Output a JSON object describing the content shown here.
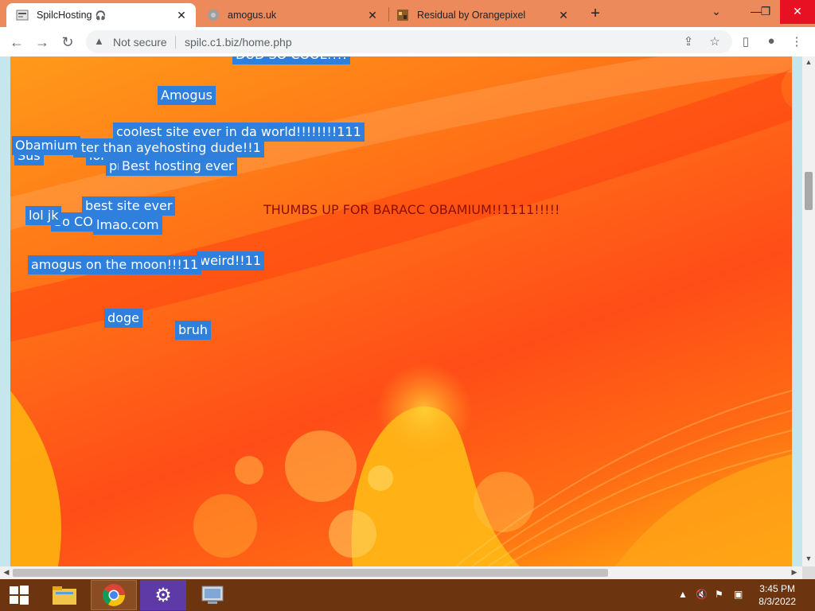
{
  "tabs": [
    {
      "title": "SpilcHosting",
      "active": true
    },
    {
      "title": "amogus.uk",
      "active": false
    },
    {
      "title": "Residual by Orangepixel",
      "active": false
    }
  ],
  "toolbar": {
    "security_label": "Not secure",
    "url": "spilc.c1.biz/home.php"
  },
  "page": {
    "comments": [
      "DUD SO COOL!!!!",
      "Amogus",
      "coolest site ever in da world!!!!!!!!111",
      "Obamium",
      "Sus",
      "-ter than ayehosting dude!!1",
      "lol xt",
      "pr",
      "Best hosting ever",
      "best site ever",
      "lol jk",
      "So CO",
      "lmao.com",
      "weird!!11",
      "amogus on the moon!!!11",
      "doge",
      "bruh"
    ],
    "banner": "THUMBS UP FOR BARACC OBAMIUM!!1111!!!!!"
  },
  "taskbar": {
    "time": "3:45 PM",
    "date": "8/3/2022"
  },
  "colors": {
    "tabstrip": "#ec8a5c",
    "label_bg": "#2f7fdc",
    "banner_text": "#8b0f00",
    "taskbar": "#6d3410"
  }
}
